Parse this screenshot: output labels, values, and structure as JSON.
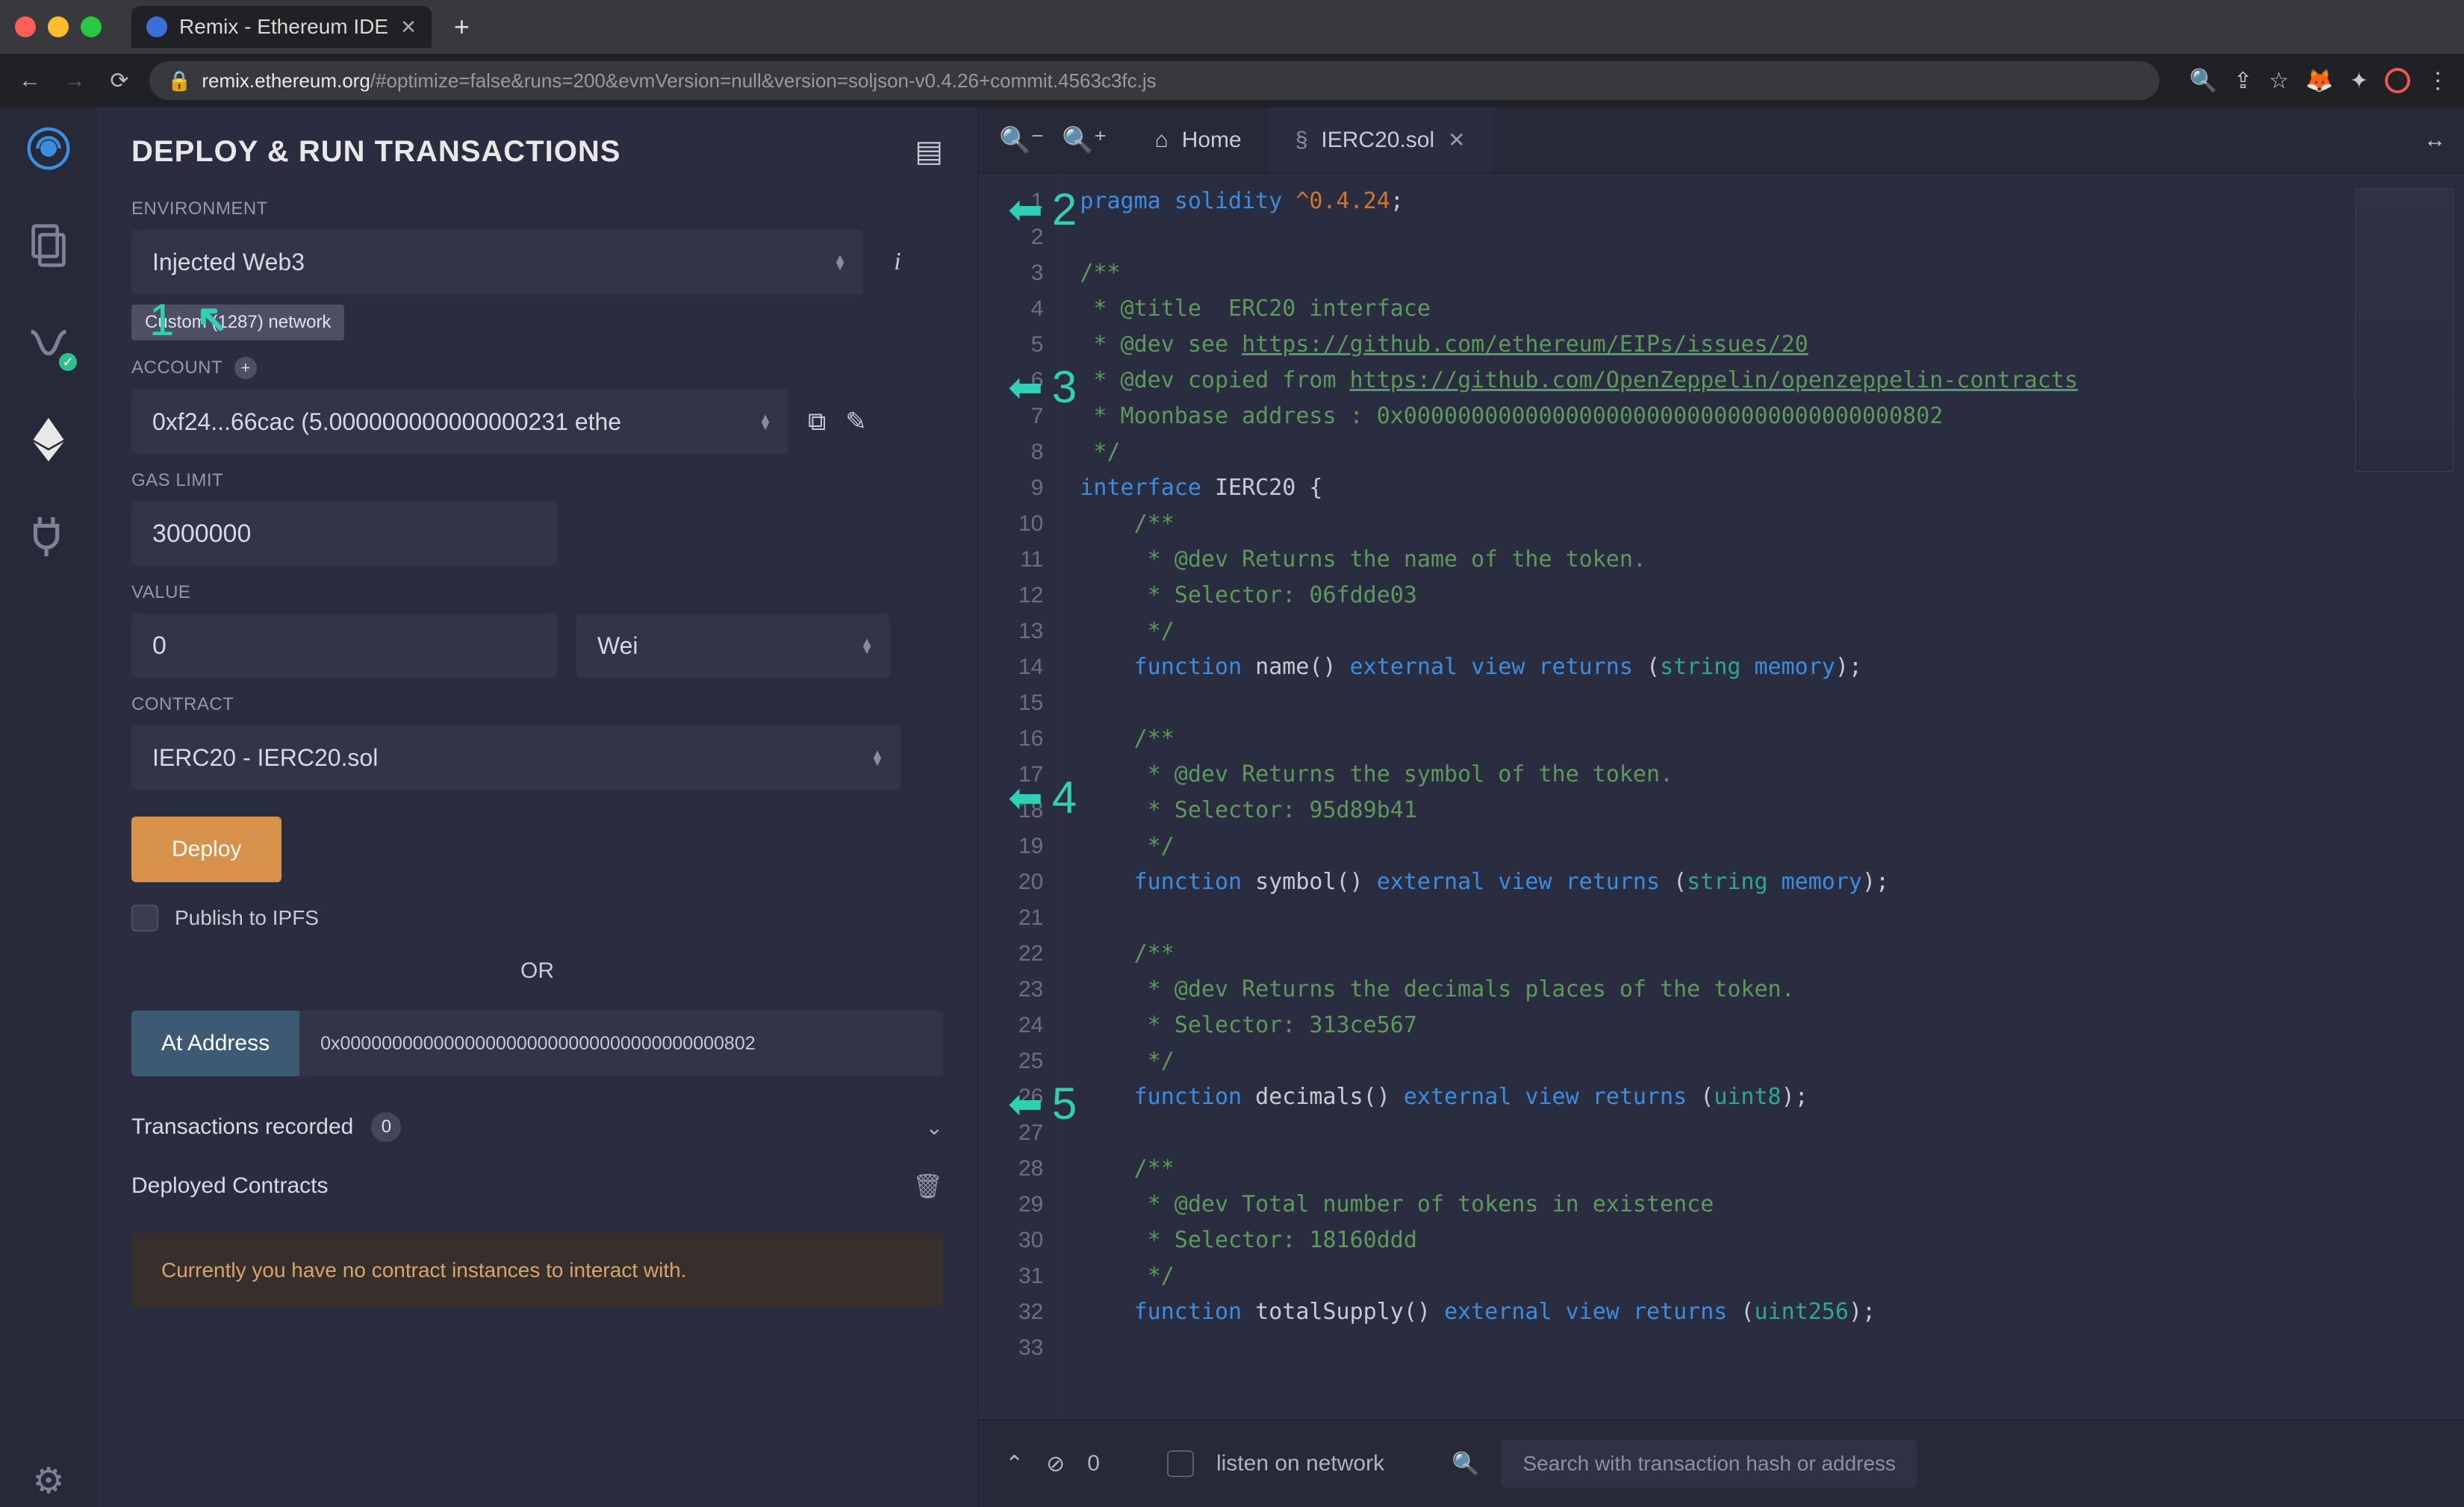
{
  "browser": {
    "tab_title": "Remix - Ethereum IDE",
    "url_host": "remix.ethereum.org",
    "url_rest": "/#optimize=false&runs=200&evmVersion=null&version=soljson-v0.4.26+commit.4563c3fc.js"
  },
  "panel": {
    "title": "DEPLOY & RUN TRANSACTIONS",
    "env_label": "ENVIRONMENT",
    "env_value": "Injected Web3",
    "net_badge": "Custom (1287) network",
    "account_label": "ACCOUNT",
    "account_value": "0xf24...66cac (5.000000000000000231 ethe",
    "gas_label": "GAS LIMIT",
    "gas_value": "3000000",
    "value_label": "VALUE",
    "value_amount": "0",
    "value_unit": "Wei",
    "contract_label": "CONTRACT",
    "contract_value": "IERC20 - IERC20.sol",
    "deploy_btn": "Deploy",
    "publish_label": "Publish to IPFS",
    "or_text": "OR",
    "at_address_btn": "At Address",
    "at_address_value": "0x0000000000000000000000000000000000000802",
    "tx_recorded": "Transactions recorded",
    "tx_count": "0",
    "deployed": "Deployed Contracts",
    "no_instances": "Currently you have no contract instances to interact with."
  },
  "tabs": {
    "home": "Home",
    "file": "IERC20.sol"
  },
  "terminal": {
    "count": "0",
    "listen": "listen on network",
    "search_placeholder": "Search with transaction hash or address"
  },
  "annot": {
    "n1": "1",
    "n2": "2",
    "n3": "3",
    "n4": "4",
    "n5": "5"
  },
  "code_lines": [
    {
      "n": "1",
      "html": "<span class='tok-kw'>pragma</span> <span class='tok-kw'>solidity</span> <span class='tok-str'>^0.4.24</span>;"
    },
    {
      "n": "2",
      "html": ""
    },
    {
      "n": "3",
      "html": "<span class='tok-com'>/**</span>"
    },
    {
      "n": "4",
      "html": "<span class='tok-com'> * @title  ERC20 interface</span>"
    },
    {
      "n": "5",
      "html": "<span class='tok-com'> * @dev see </span><span class='tok-link'>https://github.com/ethereum/EIPs/issues/20</span>"
    },
    {
      "n": "6",
      "html": "<span class='tok-com'> * @dev copied from </span><span class='tok-link'>https://github.com/OpenZeppelin/openzeppelin-contracts</span>"
    },
    {
      "n": "7",
      "html": "<span class='tok-com'> * Moonbase address : 0x0000000000000000000000000000000000000802</span>"
    },
    {
      "n": "8",
      "html": "<span class='tok-com'> */</span>"
    },
    {
      "n": "9",
      "html": "<span class='tok-kw'>interface</span> IERC20 {"
    },
    {
      "n": "10",
      "html": "    <span class='tok-com'>/**</span>"
    },
    {
      "n": "11",
      "html": "    <span class='tok-com'> * @dev Returns the name of the token.</span>"
    },
    {
      "n": "12",
      "html": "    <span class='tok-com'> * Selector: 06fdde03</span>"
    },
    {
      "n": "13",
      "html": "    <span class='tok-com'> */</span>"
    },
    {
      "n": "14",
      "html": "    <span class='tok-kw'>function</span> name() <span class='tok-kw'>external</span> <span class='tok-kw'>view</span> <span class='tok-kw'>returns</span> (<span class='tok-type'>string</span> <span class='tok-kw'>memory</span>);"
    },
    {
      "n": "15",
      "html": ""
    },
    {
      "n": "16",
      "html": "    <span class='tok-com'>/**</span>"
    },
    {
      "n": "17",
      "html": "    <span class='tok-com'> * @dev Returns the symbol of the token.</span>"
    },
    {
      "n": "18",
      "html": "    <span class='tok-com'> * Selector: 95d89b41</span>"
    },
    {
      "n": "19",
      "html": "    <span class='tok-com'> */</span>"
    },
    {
      "n": "20",
      "html": "    <span class='tok-kw'>function</span> symbol() <span class='tok-kw'>external</span> <span class='tok-kw'>view</span> <span class='tok-kw'>returns</span> (<span class='tok-type'>string</span> <span class='tok-kw'>memory</span>);"
    },
    {
      "n": "21",
      "html": ""
    },
    {
      "n": "22",
      "html": "    <span class='tok-com'>/**</span>"
    },
    {
      "n": "23",
      "html": "    <span class='tok-com'> * @dev Returns the decimals places of the token.</span>"
    },
    {
      "n": "24",
      "html": "    <span class='tok-com'> * Selector: 313ce567</span>"
    },
    {
      "n": "25",
      "html": "    <span class='tok-com'> */</span>"
    },
    {
      "n": "26",
      "html": "    <span class='tok-kw'>function</span> decimals() <span class='tok-kw'>external</span> <span class='tok-kw'>view</span> <span class='tok-kw'>returns</span> (<span class='tok-type'>uint8</span>);"
    },
    {
      "n": "27",
      "html": ""
    },
    {
      "n": "28",
      "html": "    <span class='tok-com'>/**</span>"
    },
    {
      "n": "29",
      "html": "    <span class='tok-com'> * @dev Total number of tokens in existence</span>"
    },
    {
      "n": "30",
      "html": "    <span class='tok-com'> * Selector: 18160ddd</span>"
    },
    {
      "n": "31",
      "html": "    <span class='tok-com'> */</span>"
    },
    {
      "n": "32",
      "html": "    <span class='tok-kw'>function</span> totalSupply() <span class='tok-kw'>external</span> <span class='tok-kw'>view</span> <span class='tok-kw'>returns</span> (<span class='tok-type'>uint256</span>);"
    },
    {
      "n": "33",
      "html": ""
    }
  ]
}
